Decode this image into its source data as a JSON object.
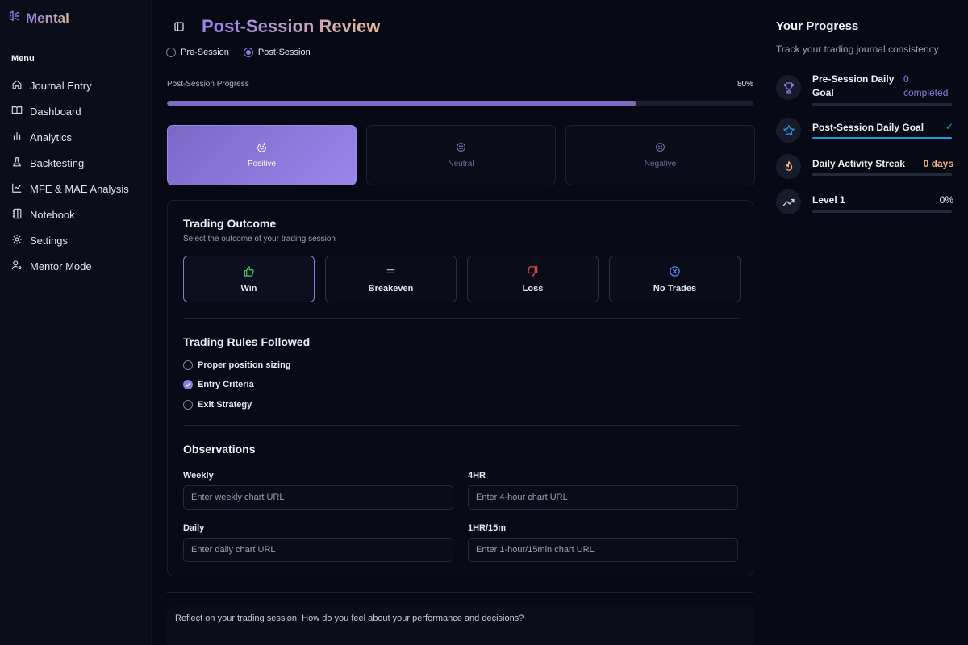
{
  "brand": {
    "name": "Mental"
  },
  "sidebar": {
    "menu_label": "Menu",
    "items": [
      {
        "label": "Journal Entry",
        "icon": "home-icon"
      },
      {
        "label": "Dashboard",
        "icon": "book-open-icon"
      },
      {
        "label": "Analytics",
        "icon": "bar-chart-icon"
      },
      {
        "label": "Backtesting",
        "icon": "flask-icon"
      },
      {
        "label": "MFE & MAE Analysis",
        "icon": "line-chart-icon"
      },
      {
        "label": "Notebook",
        "icon": "notebook-icon"
      },
      {
        "label": "Settings",
        "icon": "gear-icon"
      },
      {
        "label": "Mentor Mode",
        "icon": "user-cog-icon"
      }
    ]
  },
  "header": {
    "title": "Post-Session Review",
    "session_options": [
      "Pre-Session",
      "Post-Session"
    ],
    "selected_session": "Post-Session"
  },
  "progress": {
    "label": "Post-Session Progress",
    "percent_text": "80%",
    "percent": 80
  },
  "moods": {
    "options": [
      "Positive",
      "Neutral",
      "Negative"
    ],
    "selected": "Positive"
  },
  "outcome": {
    "title": "Trading Outcome",
    "subtitle": "Select the outcome of your trading session",
    "options": [
      "Win",
      "Breakeven",
      "Loss",
      "No Trades"
    ],
    "selected": "Win"
  },
  "rules": {
    "title": "Trading Rules Followed",
    "items": [
      {
        "label": "Proper position sizing",
        "checked": false
      },
      {
        "label": "Entry Criteria",
        "checked": true
      },
      {
        "label": "Exit Strategy",
        "checked": false
      }
    ]
  },
  "observations": {
    "title": "Observations",
    "fields": [
      {
        "label": "Weekly",
        "placeholder": "Enter weekly chart URL",
        "value": ""
      },
      {
        "label": "4HR",
        "placeholder": "Enter 4-hour chart URL",
        "value": ""
      },
      {
        "label": "Daily",
        "placeholder": "Enter daily chart URL",
        "value": ""
      },
      {
        "label": "1HR/15m",
        "placeholder": "Enter 1-hour/15min chart URL",
        "value": ""
      }
    ]
  },
  "reflection": {
    "placeholder": "Reflect on your trading session. How do you feel about your performance and decisions?"
  },
  "right_panel": {
    "title": "Your Progress",
    "subtitle": "Track your trading journal consistency",
    "goals": [
      {
        "label": "Pre-Session Daily Goal",
        "status": "0 completed",
        "progress": 0,
        "icon": "trophy-icon"
      },
      {
        "label": "Post-Session Daily Goal",
        "status": "✓",
        "progress": 1,
        "icon": "star-icon"
      },
      {
        "label": "Daily Activity Streak",
        "status": "0 days",
        "progress": 0,
        "icon": "flame-icon"
      },
      {
        "label": "Level 1",
        "status": "0%",
        "progress": 0,
        "icon": "trending-up-icon"
      }
    ]
  },
  "colors": {
    "accent": "#8d7ce0",
    "background": "#070a14",
    "streak_status": "#f3b686",
    "goal_complete": "#1f9be0"
  }
}
